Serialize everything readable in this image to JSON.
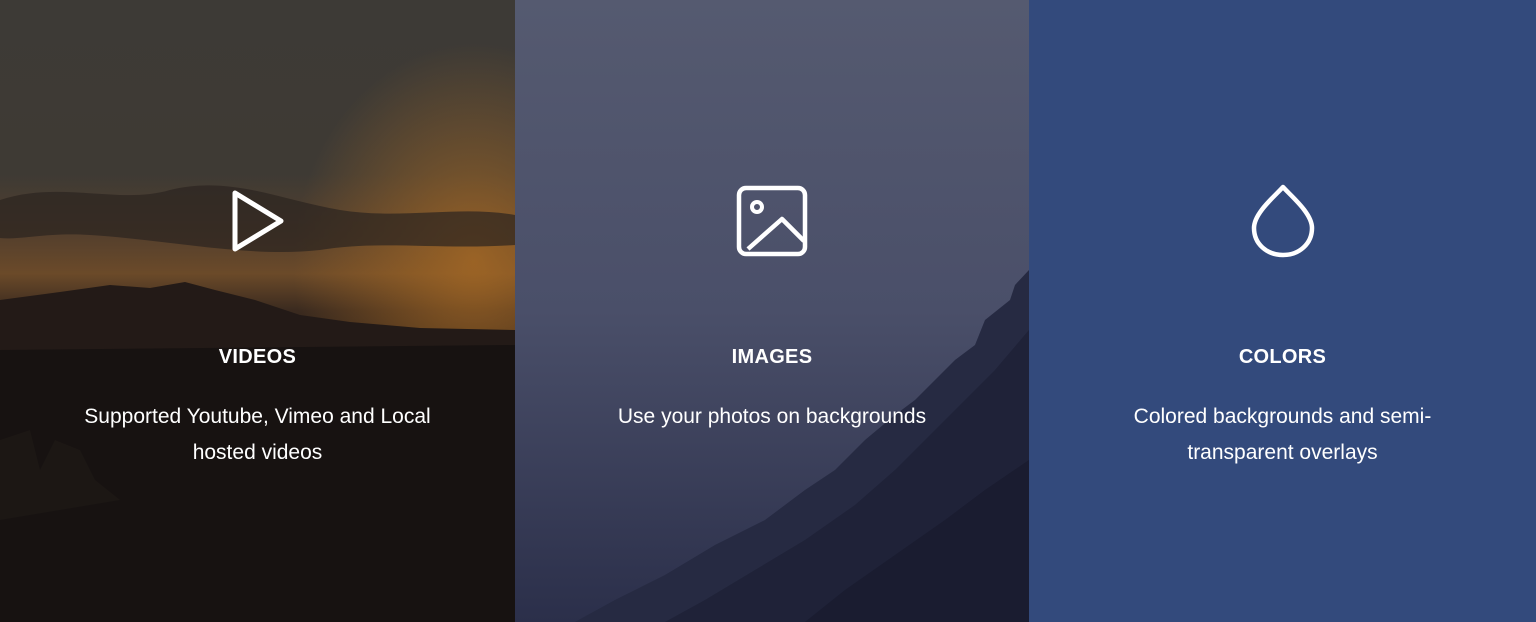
{
  "features": [
    {
      "icon": "play-icon",
      "title": "VIDEOS",
      "description": "Supported Youtube, Vimeo and Local hosted videos"
    },
    {
      "icon": "image-icon",
      "title": "IMAGES",
      "description": "Use your photos on backgrounds"
    },
    {
      "icon": "droplet-icon",
      "title": "COLORS",
      "description": "Colored backgrounds and semi-transparent overlays"
    }
  ],
  "colors": {
    "videos_overlay": "#141110",
    "images_overlay": "#2e3352",
    "colors_background": "#334a7c",
    "text": "#ffffff"
  }
}
